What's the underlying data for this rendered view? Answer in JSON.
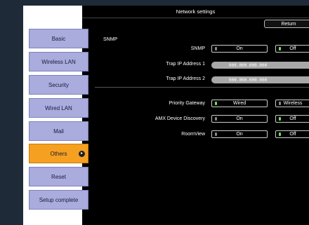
{
  "sidebar": {
    "items": [
      {
        "label": "Basic"
      },
      {
        "label": "Wireless LAN"
      },
      {
        "label": "Security"
      },
      {
        "label": "Wired LAN"
      },
      {
        "label": "Mail"
      },
      {
        "label": "Others"
      },
      {
        "label": "Reset"
      },
      {
        "label": "Setup complete"
      }
    ]
  },
  "header": {
    "title": "Network settings",
    "return_label": "Return"
  },
  "snmp": {
    "section_title": "SNMP",
    "snmp_label": "SNMP",
    "on_label": "On",
    "off_label": "Off",
    "trap1_label": "Trap IP Address 1",
    "trap1_value": "000.000.000.000",
    "trap2_label": "Trap IP Address 2",
    "trap2_value": "000.000.000.000"
  },
  "other": {
    "priority_label": "Priority Gateway",
    "wired_label": "Wired",
    "wireless_label": "Wireless",
    "amx_label": "AMX Device Discovery",
    "amx_on": "On",
    "amx_off": "Off",
    "roomview_label": "RoomView",
    "roomview_on": "On",
    "roomview_off": "Off"
  },
  "colors": {
    "sidebar_button": "#a9acdc",
    "active_button": "#f5a020",
    "selected_indicator": "#7cd86a"
  }
}
